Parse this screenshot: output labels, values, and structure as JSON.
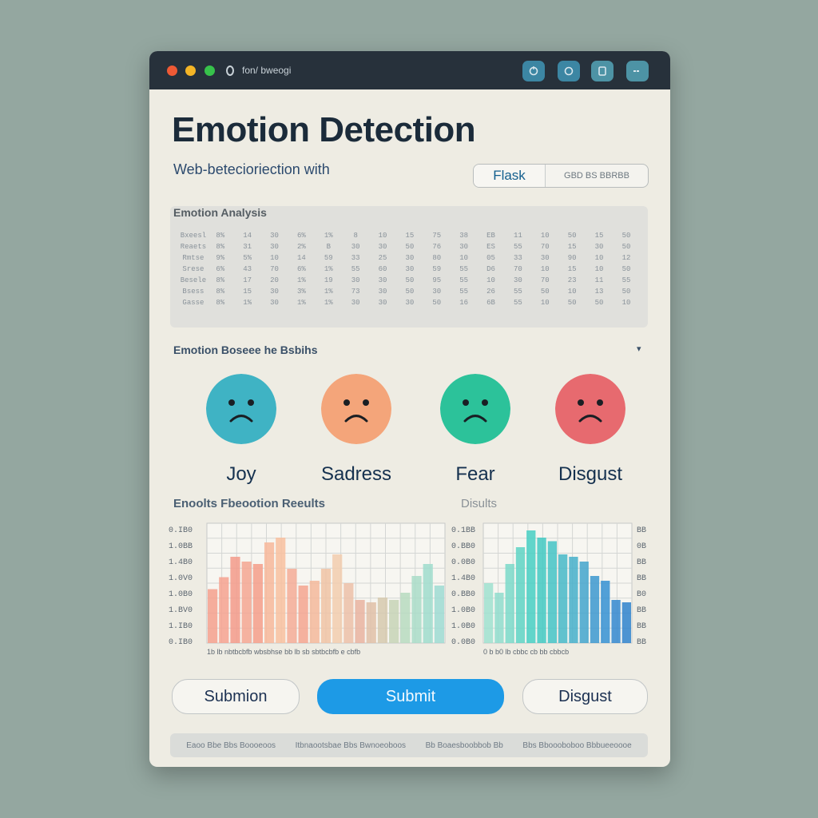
{
  "window": {
    "url_text": "fon/ bweogi",
    "toolbar_icons": [
      "refresh-icon",
      "record-icon",
      "doc-icon",
      "menu-icon"
    ]
  },
  "header": {
    "title": "Emotion Detection",
    "subtitle": "Web-betecioriection with",
    "flask_label": "Flask",
    "flask_status": "GBD BS BBRBB"
  },
  "analysis": {
    "label": "Emotion Analysis",
    "rows": [
      [
        "Bxeesl",
        "8%",
        "14",
        "30",
        "6%",
        "1%",
        "8",
        "10",
        "15",
        "75",
        "38",
        "EB",
        "11",
        "10",
        "50",
        "15",
        "50"
      ],
      [
        "Reaets",
        "8%",
        "31",
        "30",
        "2%",
        "B",
        "30",
        "30",
        "50",
        "76",
        "30",
        "ES",
        "55",
        "70",
        "15",
        "30",
        "50"
      ],
      [
        "Rmtse",
        "9%",
        "5%",
        "10",
        "14",
        "59",
        "33",
        "25",
        "30",
        "80",
        "10",
        "05",
        "33",
        "30",
        "90",
        "10",
        "12"
      ],
      [
        "Srese",
        "6%",
        "43",
        "70",
        "6%",
        "1%",
        "55",
        "60",
        "30",
        "59",
        "55",
        "D6",
        "70",
        "10",
        "15",
        "10",
        "50"
      ],
      [
        "Besele",
        "8%",
        "17",
        "20",
        "1%",
        "19",
        "30",
        "30",
        "50",
        "95",
        "55",
        "10",
        "30",
        "70",
        "23",
        "11",
        "55"
      ],
      [
        "Bsess",
        "8%",
        "15",
        "30",
        "3%",
        "1%",
        "73",
        "30",
        "50",
        "30",
        "55",
        "26",
        "55",
        "50",
        "10",
        "13",
        "50"
      ],
      [
        "Gasse",
        "8%",
        "1%",
        "30",
        "1%",
        "1%",
        "30",
        "30",
        "30",
        "50",
        "16",
        "6B",
        "55",
        "10",
        "50",
        "50",
        "10"
      ]
    ]
  },
  "emotion_section": {
    "label": "Emotion Boseee he Bsbihs",
    "items": [
      {
        "label": "Joy",
        "color": "#3fb3c4"
      },
      {
        "label": "Sadress",
        "color": "#f4a57a"
      },
      {
        "label": "Fear",
        "color": "#2cc29a"
      },
      {
        "label": "Disgust",
        "color": "#e76a6f"
      }
    ]
  },
  "results": {
    "title_left": "Enoolts Fbeootion Reeults",
    "title_right": "Disults"
  },
  "chart_data": [
    {
      "type": "bar",
      "y_tick_labels": [
        "0.IB0",
        "1.0BB",
        "1.4B0",
        "1.0V0",
        "1.0B0",
        "1.BV0",
        "1.IB0",
        "0.IB0"
      ],
      "x_caption": "1b lb nbtbcbfb wbsbhse bb lb sb sbtbcbfb e cbfb",
      "values": [
        0.45,
        0.55,
        0.72,
        0.68,
        0.66,
        0.84,
        0.88,
        0.62,
        0.48,
        0.52,
        0.62,
        0.74,
        0.5,
        0.36,
        0.34,
        0.38,
        0.36,
        0.42,
        0.56,
        0.66,
        0.48
      ],
      "colors": [
        "#f5a08d",
        "#f6a28f",
        "#f39a89",
        "#f5a692",
        "#f49d8a",
        "#f7b79a",
        "#f8c09f",
        "#f4ab96",
        "#f5a48f",
        "#f4b89b",
        "#f0c3a5",
        "#f2cdae",
        "#ecc0a8",
        "#e9b3a0",
        "#e1bfa7",
        "#d6c9ae",
        "#c7d4b6",
        "#b7dac0",
        "#a9dcc8",
        "#9fdccc",
        "#9ddad2"
      ]
    },
    {
      "type": "bar",
      "y_tick_labels": [
        "0.1BB",
        "0.BB0",
        "0.0B0",
        "1.4B0",
        "0.BB0",
        "1.0B0",
        "1.0B0",
        "0.0B0"
      ],
      "right_tick_labels": [
        "BB",
        "0B",
        "BB",
        "BB",
        "B0",
        "BB",
        "BB",
        "BB"
      ],
      "x_caption": "0 b b0 lb cbbc cb bb cbbcb",
      "values": [
        0.5,
        0.42,
        0.66,
        0.8,
        0.94,
        0.88,
        0.85,
        0.74,
        0.72,
        0.68,
        0.56,
        0.52,
        0.36,
        0.34
      ],
      "colors": [
        "#9fe0cf",
        "#8fdccc",
        "#7ad9c9",
        "#5ed3c4",
        "#46cfc3",
        "#42c9c2",
        "#44c3c6",
        "#46b9c8",
        "#45afca",
        "#43a4cc",
        "#3c98cf",
        "#3591d2",
        "#3387cf",
        "#2f83cc"
      ]
    }
  ],
  "actions": {
    "left_label": "Submion",
    "primary_label": "Submit",
    "right_label": "Disgust"
  },
  "footer": {
    "items": [
      "Eaoo Bbe Bbs Boooeoos",
      "Itbnaootsbae Bbs Bwnoeoboos",
      "Bb Boaesboobbob Bb",
      "Bbs Bboooboboo Bbbueeoooe"
    ]
  }
}
